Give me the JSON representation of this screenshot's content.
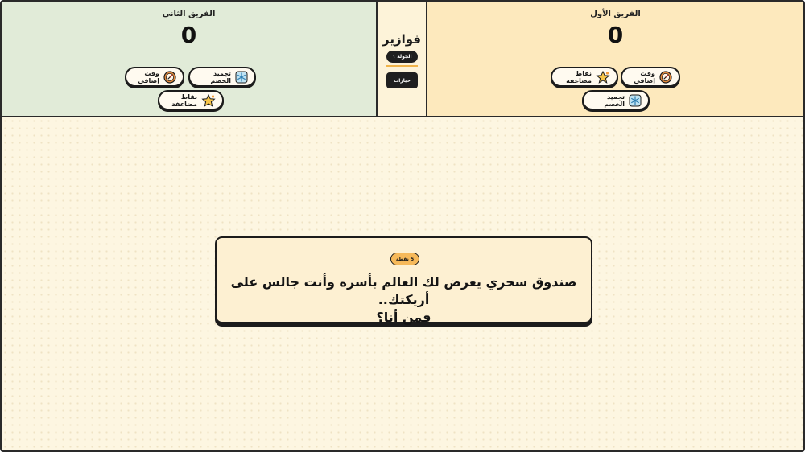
{
  "header": {
    "team_left": {
      "name": "الفريق الثاني",
      "score": "0",
      "powers": {
        "freeze": "تجميد الخصم",
        "extra_time": "وقت إضافي",
        "double_points": "نقاط مضاعفة"
      }
    },
    "center": {
      "title": "فوازير",
      "round": "الجولة ١",
      "options": "خيارات"
    },
    "team_right": {
      "name": "الفريق الأول",
      "score": "0",
      "powers": {
        "double_points": "نقاط مضاعفة",
        "extra_time": "وقت إضافي",
        "freeze": "تجميد الخصم"
      }
    }
  },
  "question": {
    "points": "5 نقطة",
    "line1": "صندوق سحري يعرض لك العالم بأسره وأنت جالس على أريكتك..",
    "line2": "فمن أنا؟"
  },
  "icons": {
    "freeze": "snowflake-icon",
    "extra_time": "stopwatch-icon",
    "double_points": "star-icon"
  },
  "colors": {
    "team_left_bg": "#e1ebd8",
    "team_right_bg": "#fde9bd",
    "center_bg": "#fdf3d9",
    "accent": "#f6b95a",
    "dark": "#1f1f1f"
  }
}
